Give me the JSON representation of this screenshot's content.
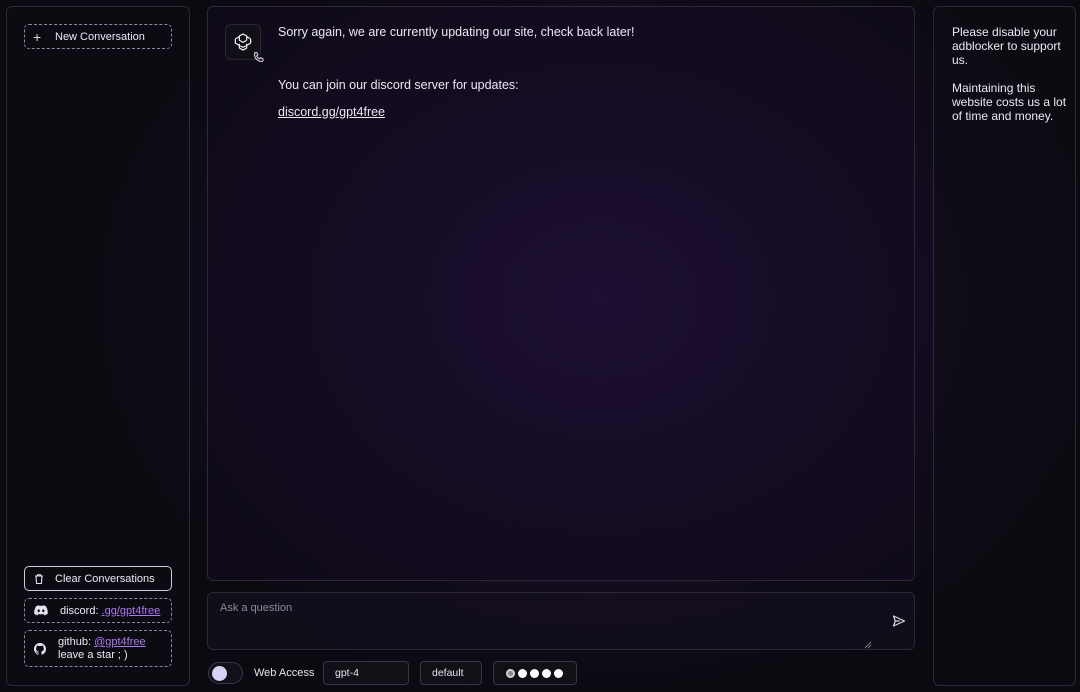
{
  "sidebar": {
    "new_conversation": "New Conversation",
    "clear_conversations": "Clear Conversations",
    "discord": {
      "prefix": "discord: ",
      "link": ".gg/gpt4free"
    },
    "github": {
      "prefix": "github: ",
      "link": "@gpt4free",
      "note": "leave a star ; )"
    }
  },
  "chat": {
    "messages": [
      "Sorry again, we are currently updating our site, check back later!",
      "You can join our discord server for updates:"
    ],
    "link": "discord.gg/gpt4free"
  },
  "input": {
    "placeholder": "Ask a question"
  },
  "controls": {
    "web_access_label": "Web Access",
    "web_access_enabled": false,
    "model": "gpt-4",
    "jailbreak": "default",
    "rating_selected": 1,
    "rating_total": 5
  },
  "ad": {
    "line1": "Please disable your adblocker to support us.",
    "line2": "Maintaining this website costs us a lot of time and money."
  },
  "colors": {
    "accent": "#a879f2",
    "background": "#0f0b17",
    "panel_border": "#2c2838"
  },
  "icons": [
    "plus-icon",
    "trash-icon",
    "discord-icon",
    "github-icon",
    "openai-logo-icon",
    "send-icon"
  ]
}
